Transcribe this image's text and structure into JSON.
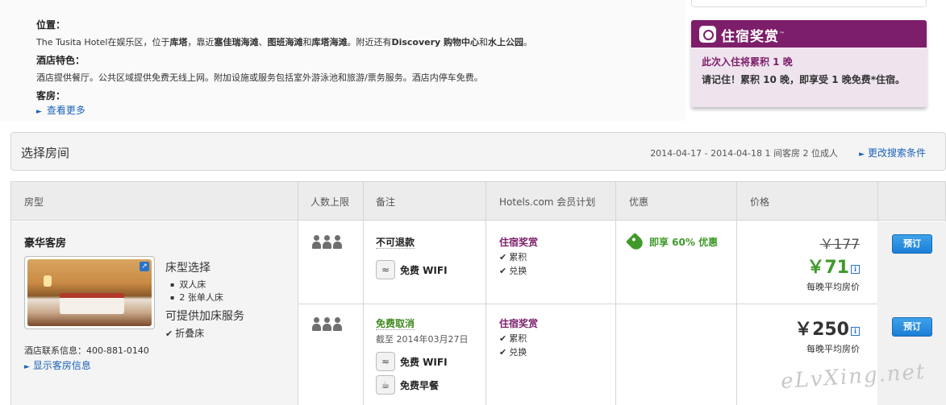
{
  "hotel_info": {
    "location_heading": "位置：",
    "location_text_parts": [
      {
        "text": "The Tusita Hotel在娱乐区，位于",
        "bold": false
      },
      {
        "text": "库塔",
        "bold": true
      },
      {
        "text": "，靠近",
        "bold": false
      },
      {
        "text": "塞佳瑞海滩",
        "bold": true
      },
      {
        "text": "、",
        "bold": false
      },
      {
        "text": "图班海滩",
        "bold": true
      },
      {
        "text": "和",
        "bold": false
      },
      {
        "text": "库塔海滩",
        "bold": true
      },
      {
        "text": "。附近还有",
        "bold": false
      },
      {
        "text": "Discovery 购物中心",
        "bold": true
      },
      {
        "text": "和",
        "bold": false
      },
      {
        "text": "水上公园",
        "bold": true
      },
      {
        "text": "。",
        "bold": false
      }
    ],
    "features_heading": "酒店特色：",
    "features_text": "酒店提供餐厅。公共区域提供免费无线上网。附加设施或服务包括室外游泳池和旅游/票务服务。酒店内停车免费。",
    "rooms_heading": "客房：",
    "see_more": "查看更多"
  },
  "rewards_card": {
    "title": "住宿奖赏",
    "tm": "™",
    "line1": "此次入住将累积 1 晚",
    "line2": "请记住！累积 10 晚，即享受 1 晚免费*住宿。"
  },
  "select_bar": {
    "title": "选择房间",
    "dates": "2014-04-17  -  2014-04-18 1 间客房 2 位成人",
    "change_link": "更改搜索条件"
  },
  "table": {
    "headers": [
      "房型",
      "人数上限",
      "备注",
      "Hotels.com 会员计划",
      "优惠",
      "价格"
    ],
    "room": {
      "name": "豪华客房",
      "bed_choice_title": "床型选择",
      "bed_options": [
        "双人床",
        "2 张单人床"
      ],
      "extra_bed_title": "可提供加床服务",
      "extra_bed_item": "折叠床",
      "phone": "酒店联系信息：400-881-0140",
      "show_info": "显示客房信息"
    },
    "rates": [
      {
        "note_title": "不可退款",
        "note_style": "strong",
        "deadline": "",
        "amenities": [
          {
            "icon": "wifi-icon",
            "label": "免费 WIFI"
          }
        ],
        "member_title": "住宿奖赏",
        "member_items": [
          "累积",
          "兑换"
        ],
        "discount": "即享 60% 优惠",
        "old_price": "￥177",
        "price": "￥71",
        "per_night": "每晚平均房价",
        "book": "预订"
      },
      {
        "note_title": "免费取消",
        "note_style": "green",
        "deadline": "截至 2014年03月27日",
        "amenities": [
          {
            "icon": "wifi-icon",
            "label": "免费 WIFI"
          },
          {
            "icon": "coffee-icon",
            "label": "免费早餐"
          }
        ],
        "member_title": "住宿奖赏",
        "member_items": [
          "累积",
          "兑换"
        ],
        "discount": "",
        "old_price": "",
        "price": "￥250",
        "per_night": "每晚平均房价",
        "book": "预订"
      }
    ]
  },
  "watermark": "eLvXing.net",
  "colors": {
    "brand_purple": "#7d1e6a",
    "link_blue": "#1a62b9",
    "deal_green": "#3f9a2a",
    "button_blue": "#1c7ed6"
  }
}
